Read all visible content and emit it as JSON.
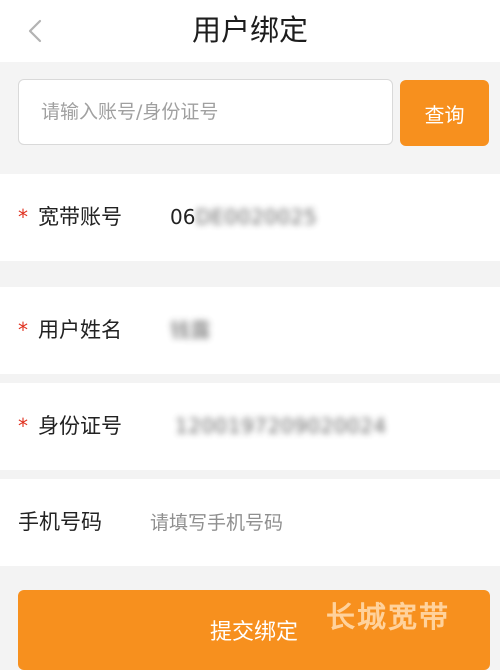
{
  "header": {
    "title": "用户绑定",
    "back_icon": "chevron-left-icon"
  },
  "search": {
    "placeholder": "请输入账号/身份证号",
    "button_label": "查询"
  },
  "form": {
    "broadband_account": {
      "label": "宽带账号",
      "value_prefix": "06",
      "value_blurred": "DE0020025"
    },
    "user_name": {
      "label": "用户姓名",
      "value_blurred": "钱露"
    },
    "id_number": {
      "label": "身份证号",
      "value_blurred": "1200197209020024"
    },
    "phone": {
      "label": "手机号码",
      "placeholder": "请填写手机号码"
    },
    "required_mark": "*"
  },
  "submit": {
    "label": "提交绑定"
  },
  "watermark": {
    "text": "长城宽带"
  },
  "colors": {
    "accent": "#f7901e",
    "required": "#e0301e",
    "page_bg": "#f3f3f3"
  }
}
